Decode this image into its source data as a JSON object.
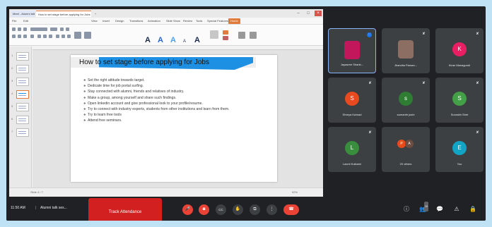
{
  "browser": {
    "tabs": [
      "Meet - Alumni talk",
      "How to set stage before applying for Jobs"
    ],
    "new_tab": "+"
  },
  "presentation": {
    "menu": [
      "File",
      "Edit",
      "View",
      "Insert",
      "Design",
      "Transitions",
      "Animation",
      "Slide Show",
      "Review",
      "Tools",
      "Special Features",
      "Home"
    ],
    "active_menu": "Home",
    "style_samples": [
      "A",
      "A",
      "A",
      "A",
      "A"
    ],
    "slide_numbers": [
      "1",
      "2",
      "3",
      "4",
      "5",
      "6",
      "7"
    ],
    "slide": {
      "title": "How to set stage before applying for Jobs",
      "bullets": [
        "Set the right attitude towards target.",
        "Dedicate time for job portal surfing.",
        "Stay connected with alumni, friends and relatives of industry.",
        "Make a group, among yourself and share such findings.",
        "Open linkedin account and give professional look to your profile/resume.",
        "Try to connect with industry experts, students from other institutions and learn from them.",
        "Try to learn free tools",
        "Attend free seminars."
      ]
    },
    "status_left": "Slide 4 / 7",
    "zoom": "92%"
  },
  "participants": [
    {
      "name": "Jayasree Shanb...",
      "initial": "",
      "color": "#c2185b",
      "photo": true,
      "mic": "active"
    },
    {
      "name": "Jhanvita Parsan...",
      "initial": "",
      "color": "#8d6e63",
      "photo": true,
      "mic": "muted"
    },
    {
      "name": "Kiran Managundi",
      "initial": "K",
      "color": "#e91e63",
      "photo": false,
      "mic": "muted"
    },
    {
      "name": "Shreya Kulwad",
      "initial": "S",
      "color": "#e8491f",
      "photo": false,
      "mic": "muted"
    },
    {
      "name": "sumanth joshi",
      "initial": "s",
      "color": "#2e7d32",
      "photo": false,
      "mic": "muted"
    },
    {
      "name": "Sourabh Shet",
      "initial": "S",
      "color": "#43a047",
      "photo": false,
      "mic": "muted"
    },
    {
      "name": "Laxmi Kulkarni",
      "initial": "L",
      "color": "#388e3c",
      "photo": false,
      "mic": "muted"
    },
    {
      "name": "20 others",
      "initial": "",
      "color": "#e8491f",
      "photo": false,
      "mic": "none"
    },
    {
      "name": "You",
      "initial": "E",
      "color": "#12a4c4",
      "photo": false,
      "mic": "muted"
    }
  ],
  "others_dots": [
    "P",
    "A"
  ],
  "meeting": {
    "time": "11:50 AM",
    "separator": "|",
    "title": "Alumni talk ses...",
    "track_button": "Track Attendance",
    "people_count": "28"
  },
  "controls": {
    "mic": "🎤",
    "cam": "◙",
    "cc": "CC",
    "hand": "✋",
    "present": "⧉",
    "more": "⋮",
    "end": "☎"
  },
  "right_icons": {
    "info": "ⓘ",
    "people": "👥",
    "chat": "💬",
    "activities": "⚠",
    "lock": "🔒"
  },
  "colors": {
    "accent": "#e07b39",
    "meet_bg": "#202124",
    "tile_bg": "#3c4043",
    "red": "#ea4335",
    "track": "#d21f1f",
    "slide_title_band": "#1e90e3"
  }
}
